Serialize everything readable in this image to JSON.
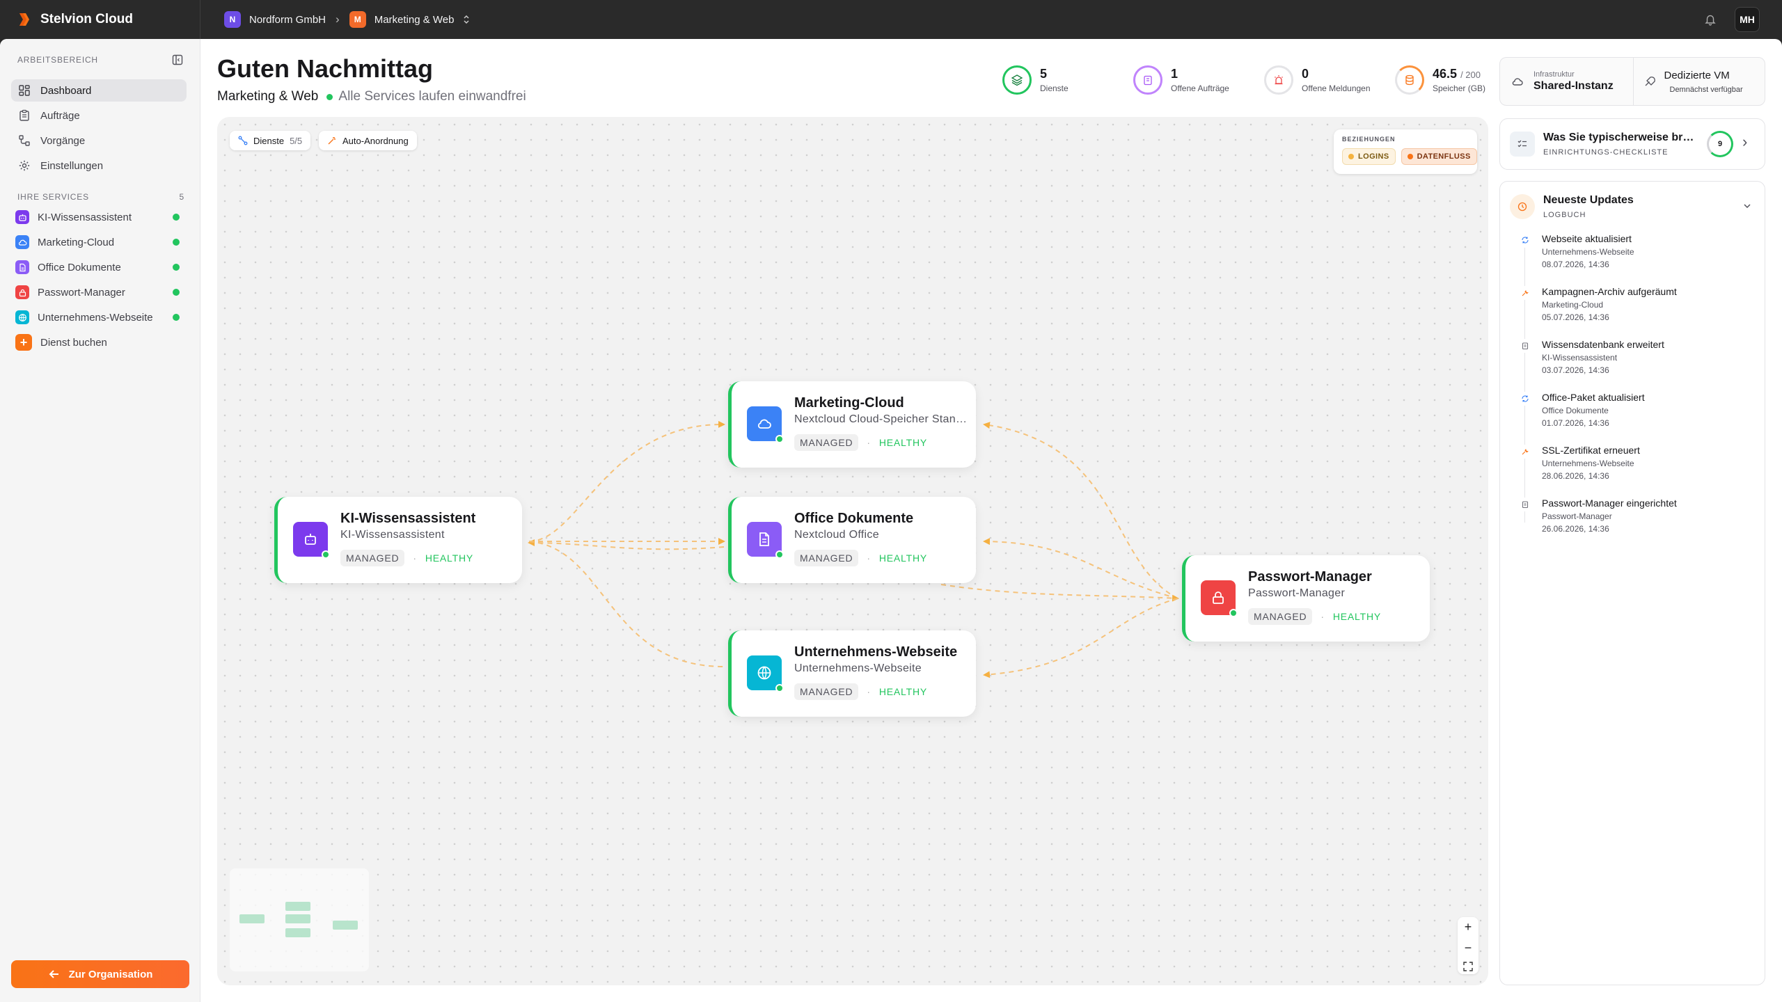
{
  "app": {
    "name": "Stelvion Cloud"
  },
  "breadcrumb": {
    "org": {
      "initial": "N",
      "label": "Nordform GmbH",
      "color": "#6d4de6"
    },
    "project": {
      "initial": "M",
      "label": "Marketing & Web",
      "color": "#f26a2a"
    }
  },
  "user": {
    "initials": "MH"
  },
  "sidebar": {
    "section_title": "ARBEITSBEREICH",
    "nav": [
      {
        "label": "Dashboard",
        "icon": "dashboard-icon"
      },
      {
        "label": "Aufträge",
        "icon": "clipboard-icon"
      },
      {
        "label": "Vorgänge",
        "icon": "workflow-icon"
      },
      {
        "label": "Einstellungen",
        "icon": "gear-icon"
      }
    ],
    "services_title": "IHRE SERVICES",
    "services_count": "5",
    "services": [
      {
        "label": "KI-Wissensassistent",
        "color": "#7c3aed"
      },
      {
        "label": "Marketing-Cloud",
        "color": "#3b82f6"
      },
      {
        "label": "Office Dokumente",
        "color": "#8b5cf6"
      },
      {
        "label": "Passwort-Manager",
        "color": "#ef4444"
      },
      {
        "label": "Unternehmens-Webseite",
        "color": "#06b6d4"
      }
    ],
    "book_service": "Dienst buchen",
    "org_button": "Zur Organisation"
  },
  "header": {
    "greeting": "Guten Nachmittag",
    "project": "Marketing & Web",
    "status": "Alle Services laufen einwandfrei"
  },
  "stats": [
    {
      "value": "5",
      "suffix": "",
      "label": "Dienste",
      "color": "#22c55e"
    },
    {
      "value": "1",
      "suffix": "",
      "label": "Offene Aufträge",
      "color": "#c084fc"
    },
    {
      "value": "0",
      "suffix": "",
      "label": "Offene Meldungen",
      "color": "#d4d4d8"
    },
    {
      "value": "46.5",
      "suffix": "/ 200",
      "label": "Speicher (GB)",
      "color": "#fb923c",
      "fraction": 0.2325
    }
  ],
  "infra": {
    "label": "Infrastruktur",
    "value": "Shared-Instanz",
    "alt_title": "Dedizierte VM",
    "alt_sub": "Demnächst verfügbar"
  },
  "canvas": {
    "chip_services": {
      "label": "Dienste",
      "count": "5/5"
    },
    "chip_arrange": "Auto-Anordnung",
    "legend": {
      "title": "BEZIEHUNGEN",
      "logins": "LOGINS",
      "dataflow": "DATENFLUSS"
    }
  },
  "nodes": [
    {
      "id": "ki",
      "title": "KI-Wissensassistent",
      "sub": "KI-Wissensassistent",
      "tag": "MANAGED",
      "status": "HEALTHY",
      "color": "#7c3aed"
    },
    {
      "id": "mc",
      "title": "Marketing-Cloud",
      "sub": "Nextcloud Cloud-Speicher Standard",
      "tag": "MANAGED",
      "status": "HEALTHY",
      "color": "#3b82f6"
    },
    {
      "id": "od",
      "title": "Office Dokumente",
      "sub": "Nextcloud Office",
      "tag": "MANAGED",
      "status": "HEALTHY",
      "color": "#8b5cf6"
    },
    {
      "id": "uw",
      "title": "Unternehmens-Webseite",
      "sub": "Unternehmens-Webseite",
      "tag": "MANAGED",
      "status": "HEALTHY",
      "color": "#06b6d4"
    },
    {
      "id": "pm",
      "title": "Passwort-Manager",
      "sub": "Passwort-Manager",
      "tag": "MANAGED",
      "status": "HEALTHY",
      "color": "#ef4444"
    }
  ],
  "checklist": {
    "title": "Was Sie typischerweise brauchen",
    "sub": "EINRICHTUNGS-CHECKLISTE",
    "count": "9"
  },
  "updates": {
    "title": "Neueste Updates",
    "sub": "LOGBUCH",
    "items": [
      {
        "title": "Webseite aktualisiert",
        "service": "Unternehmens-Webseite",
        "date": "08.07.2026, 14:36",
        "icon": "refresh-icon"
      },
      {
        "title": "Kampagnen-Archiv aufgeräumt",
        "service": "Marketing-Cloud",
        "date": "05.07.2026, 14:36",
        "icon": "wrench-icon"
      },
      {
        "title": "Wissensdatenbank erweitert",
        "service": "KI-Wissensassistent",
        "date": "03.07.2026, 14:36",
        "icon": "clipboard-icon"
      },
      {
        "title": "Office-Paket aktualisiert",
        "service": "Office Dokumente",
        "date": "01.07.2026, 14:36",
        "icon": "refresh-icon"
      },
      {
        "title": "SSL-Zertifikat erneuert",
        "service": "Unternehmens-Webseite",
        "date": "28.06.2026, 14:36",
        "icon": "wrench-icon"
      },
      {
        "title": "Passwort-Manager eingerichtet",
        "service": "Passwort-Manager",
        "date": "26.06.2026, 14:36",
        "icon": "clipboard-icon"
      }
    ]
  }
}
